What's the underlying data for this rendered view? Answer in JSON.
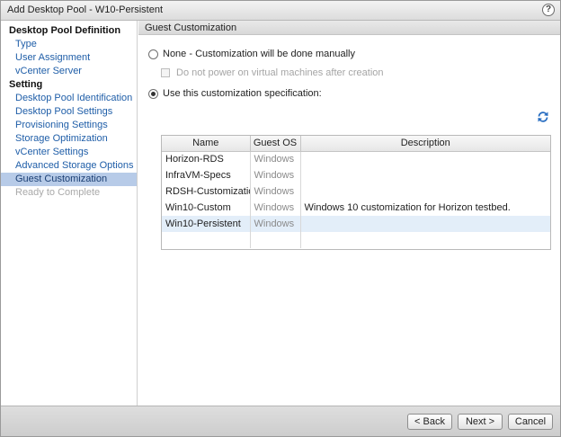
{
  "window": {
    "title": "Add Desktop Pool - W10-Persistent",
    "help_label": "?"
  },
  "sidebar": {
    "sections": [
      {
        "label": "Desktop Pool Definition",
        "items": [
          {
            "label": "Type"
          },
          {
            "label": "User Assignment"
          },
          {
            "label": "vCenter Server"
          }
        ]
      },
      {
        "label": "Setting",
        "items": [
          {
            "label": "Desktop Pool Identification"
          },
          {
            "label": "Desktop Pool Settings"
          },
          {
            "label": "Provisioning Settings"
          },
          {
            "label": "Storage Optimization"
          },
          {
            "label": "vCenter Settings"
          },
          {
            "label": "Advanced Storage Options"
          },
          {
            "label": "Guest Customization"
          },
          {
            "label": "Ready to Complete"
          }
        ]
      }
    ],
    "active_item": "Guest Customization"
  },
  "content": {
    "header": "Guest Customization",
    "option_none": "None - Customization will be done manually",
    "option_none_checkbox": "Do not power on virtual machines after creation",
    "option_spec": "Use this customization specification:",
    "selected_option": "spec"
  },
  "table": {
    "columns": [
      "Name",
      "Guest OS",
      "Description"
    ],
    "rows": [
      {
        "name": "Horizon-RDS",
        "os": "Windows",
        "description": ""
      },
      {
        "name": "InfraVM-Specs",
        "os": "Windows",
        "description": ""
      },
      {
        "name": "RDSH-Customization",
        "os": "Windows",
        "description": ""
      },
      {
        "name": "Win10-Custom",
        "os": "Windows",
        "description": "Windows 10 customization for Horizon testbed."
      },
      {
        "name": "Win10-Persistent",
        "os": "Windows",
        "description": ""
      }
    ],
    "selected_row": "Win10-Persistent"
  },
  "footer": {
    "back_label": "< Back",
    "next_label": "Next >",
    "cancel_label": "Cancel"
  },
  "icons": {
    "help": "help-icon",
    "refresh": "refresh-icon"
  }
}
